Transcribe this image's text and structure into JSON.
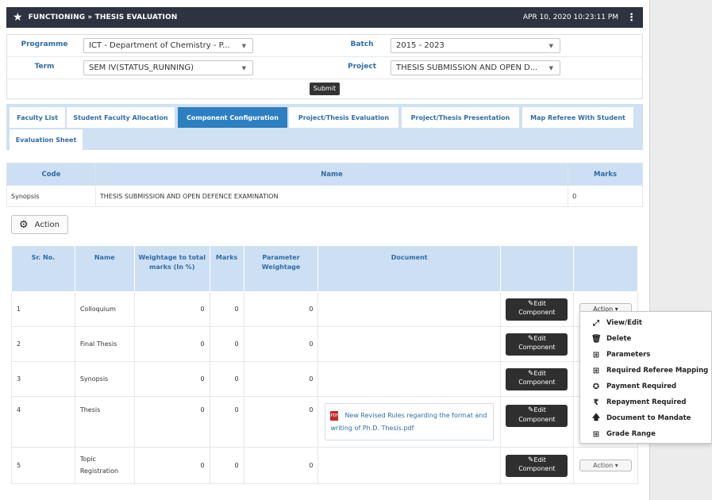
{
  "header": {
    "breadcrumb": "FUNCTIONING » THESIS EVALUATION",
    "datetime": "APR 10, 2020  10:23:11 PM"
  },
  "filters": {
    "programme_label": "Programme",
    "programme_value": "ICT - Department of Chemistry - P...",
    "batch_label": "Batch",
    "batch_value": "2015 - 2023",
    "term_label": "Term",
    "term_value": "SEM IV(STATUS_RUNNING)",
    "project_label": "Project",
    "project_value": "THESIS SUBMISSION AND OPEN D...",
    "submit_label": "Submit"
  },
  "tabs": [
    {
      "label": "Faculty List"
    },
    {
      "label": "Student Faculty Allocation"
    },
    {
      "label": "Component Configuration"
    },
    {
      "label": "Project/Thesis Evaluation"
    },
    {
      "label": "Project/Thesis Presentation"
    },
    {
      "label": "Map Referee With Student"
    },
    {
      "label": "Evaluation Sheet"
    }
  ],
  "active_tab": "Component Configuration",
  "code_table": {
    "headers": {
      "code": "Code",
      "name": "Name",
      "marks": "Marks"
    },
    "row": {
      "code": "Synopsis",
      "name": "THESIS SUBMISSION AND OPEN DEFENCE EXAMINATION",
      "marks": "0"
    }
  },
  "action_button": "Action",
  "components": {
    "headers": {
      "sr": "Sr. No.",
      "name": "Name",
      "weightage": "Weightage to total marks (In %)",
      "marks": "Marks",
      "param": "Parameter Weightage",
      "document": "Document"
    },
    "edit_label_1": "Edit",
    "edit_label_2": "Component",
    "action_label": "Action",
    "rows": [
      {
        "sr": "1",
        "name": "Colloquium",
        "weightage": "0",
        "marks": "0",
        "param": "0",
        "document": ""
      },
      {
        "sr": "2",
        "name": "Final Thesis",
        "weightage": "0",
        "marks": "0",
        "param": "0",
        "document": ""
      },
      {
        "sr": "3",
        "name": "Synopsis",
        "weightage": "0",
        "marks": "0",
        "param": "0",
        "document": ""
      },
      {
        "sr": "4",
        "name": "Thesis",
        "weightage": "0",
        "marks": "0",
        "param": "0",
        "document": "New Revised Rules regarding the format and writing of Ph.D. Thesis.pdf"
      },
      {
        "sr": "5",
        "name": "Topic Registration",
        "weightage": "0",
        "marks": "0",
        "param": "0",
        "document": ""
      }
    ]
  },
  "action_menu": [
    {
      "label": "View/Edit",
      "icon": "expand-icon"
    },
    {
      "label": "Delete",
      "icon": "trash-icon"
    },
    {
      "label": "Parameters",
      "icon": "plus-square-icon"
    },
    {
      "label": "Required Referee Mapping",
      "icon": "plus-square-icon"
    },
    {
      "label": "Payment Required",
      "icon": "badge-check-icon"
    },
    {
      "label": "Repayment Required",
      "icon": "rupee-icon"
    },
    {
      "label": "Document to Mandate",
      "icon": "arrow-up-icon"
    },
    {
      "label": "Grade Range",
      "icon": "plus-square-icon"
    }
  ]
}
